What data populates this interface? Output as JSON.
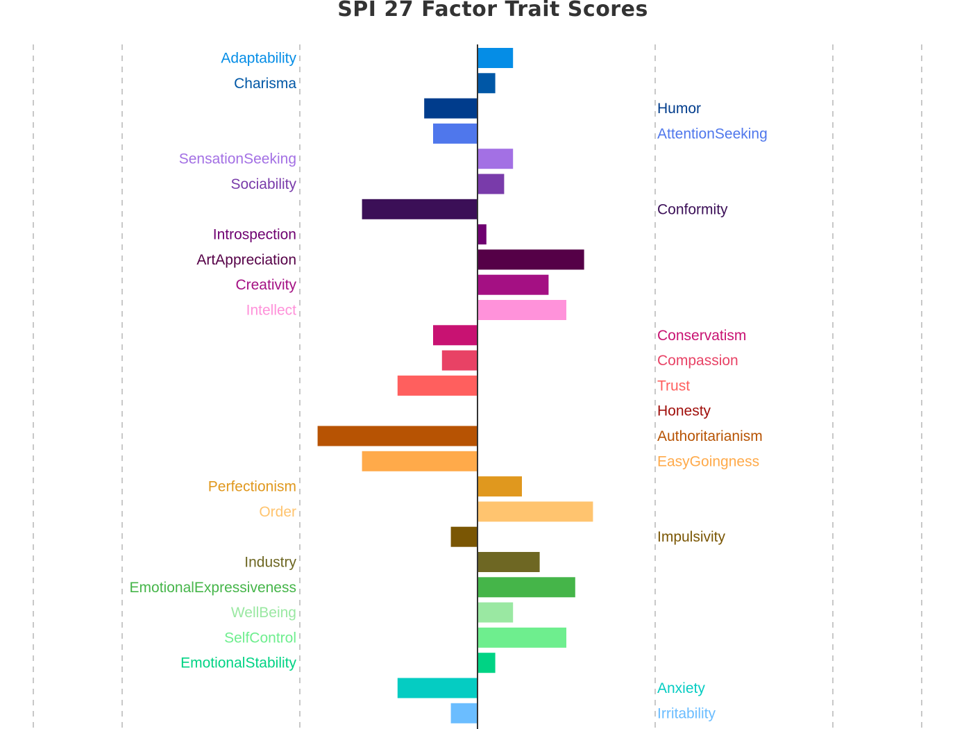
{
  "chart_data": {
    "type": "bar",
    "orientation": "horizontal",
    "title": "SPI 27 Factor Trait Scores",
    "xlabel": "",
    "ylabel": "",
    "xlim": [
      -5.2,
      5.4
    ],
    "gridlines_x": [
      -5,
      -4,
      -2,
      2,
      4,
      5
    ],
    "grid": true,
    "legend": "none",
    "label_placement": "positive values labeled left of axis, non-positive values labeled right of axis",
    "categories": [
      "Adaptability",
      "Charisma",
      "Humor",
      "AttentionSeeking",
      "SensationSeeking",
      "Sociability",
      "Conformity",
      "Introspection",
      "ArtAppreciation",
      "Creativity",
      "Intellect",
      "Conservatism",
      "Compassion",
      "Trust",
      "Honesty",
      "Authoritarianism",
      "EasyGoingness",
      "Perfectionism",
      "Order",
      "Impulsivity",
      "Industry",
      "EmotionalExpressiveness",
      "WellBeing",
      "SelfControl",
      "EmotionalStability",
      "Anxiety",
      "Irritability"
    ],
    "values": [
      0.4,
      0.2,
      -0.6,
      -0.5,
      0.4,
      0.3,
      -1.3,
      0.1,
      1.2,
      0.8,
      1.0,
      -0.5,
      -0.4,
      -0.9,
      0.0,
      -1.8,
      -1.3,
      0.5,
      1.3,
      -0.3,
      0.7,
      1.1,
      0.4,
      1.0,
      0.2,
      -0.9,
      -0.3
    ],
    "colors": [
      "#058DE6",
      "#0057A6",
      "#003C8C",
      "#4F77EC",
      "#A370E4",
      "#793BAA",
      "#3B0F57",
      "#6E0070",
      "#550047",
      "#A41083",
      "#FF92DA",
      "#C81272",
      "#E84265",
      "#FF5F5E",
      "#A00F0B",
      "#B75303",
      "#FFAA4A",
      "#E0981E",
      "#FFC46F",
      "#7A5604",
      "#6E6723",
      "#45B549",
      "#9AE8A2",
      "#6EEE8E",
      "#00D384",
      "#05CCC2",
      "#6BBDFF"
    ]
  }
}
